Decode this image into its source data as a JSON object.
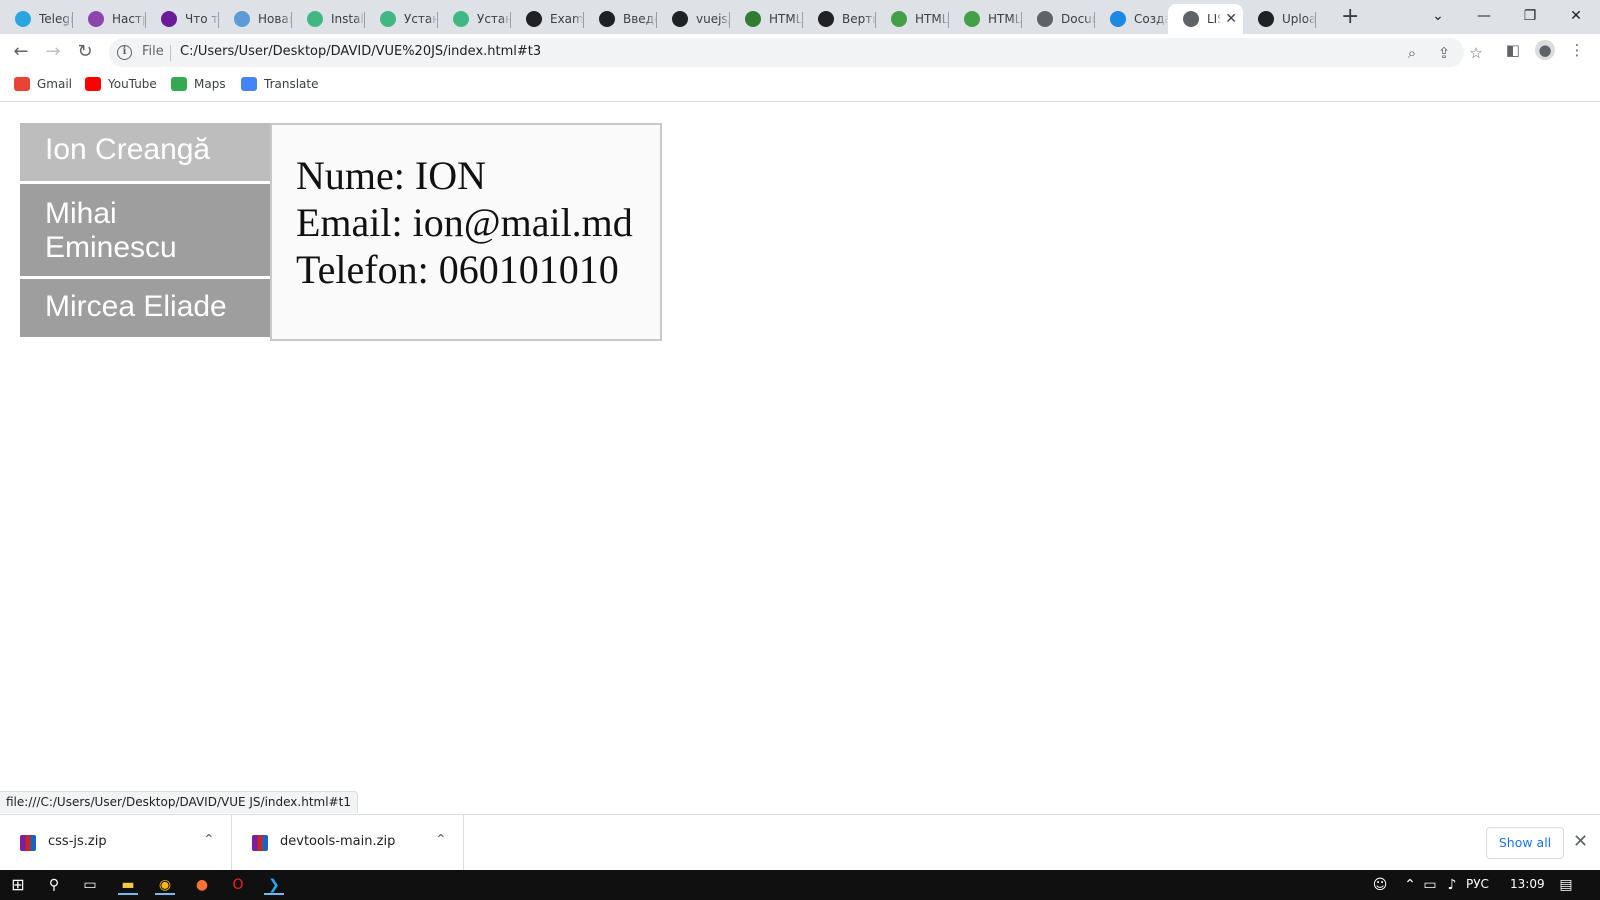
{
  "browser": {
    "tabs": [
      {
        "title": "Telegram",
        "icon": "telegram-icon",
        "color": "#2aa5e0"
      },
      {
        "title": "Настройка",
        "icon": "vue-icon",
        "color": "#8e44ad"
      },
      {
        "title": "Что такое",
        "icon": "flag-icon",
        "color": "#6a1b9a"
      },
      {
        "title": "Новая",
        "icon": "cloud-icon",
        "color": "#5c9bd6"
      },
      {
        "title": "Installation",
        "icon": "vue-icon",
        "color": "#41b883"
      },
      {
        "title": "Установка",
        "icon": "vue-icon",
        "color": "#41b883"
      },
      {
        "title": "Установка",
        "icon": "vue-icon",
        "color": "#41b883"
      },
      {
        "title": "Example",
        "icon": "codepen-icon",
        "color": "#202124"
      },
      {
        "title": "Введение",
        "icon": "m-icon",
        "color": "#202124"
      },
      {
        "title": "vuejs/",
        "icon": "github-icon",
        "color": "#202124"
      },
      {
        "title": "HTML",
        "icon": "leaf-icon",
        "color": "#2e7d32"
      },
      {
        "title": "Вертикальное",
        "icon": "codepen-icon",
        "color": "#202124"
      },
      {
        "title": "HTML",
        "icon": "check-icon",
        "color": "#43a047"
      },
      {
        "title": "HTML",
        "icon": "check-icon",
        "color": "#43a047"
      },
      {
        "title": "Document",
        "icon": "globe-icon",
        "color": "#5f6368"
      },
      {
        "title": "Создание",
        "icon": "c-icon",
        "color": "#1e88e5"
      },
      {
        "title": "LIST",
        "icon": "globe-icon",
        "color": "#5f6368",
        "active": true
      },
      {
        "title": "Upload",
        "icon": "github-icon",
        "color": "#202124"
      }
    ],
    "address": {
      "scheme_label": "File",
      "url": "C:/Users/User/Desktop/DAVID/VUE%20JS/index.html#t3"
    },
    "bookmarks": [
      {
        "label": "Gmail",
        "icon": "gmail-icon",
        "color": "#ea4335"
      },
      {
        "label": "YouTube",
        "icon": "youtube-icon",
        "color": "#ff0000"
      },
      {
        "label": "Maps",
        "icon": "maps-icon",
        "color": "#34a853"
      },
      {
        "label": "Translate",
        "icon": "translate-icon",
        "color": "#4285f4"
      }
    ],
    "status_url": "file:///C:/Users/User/Desktop/DAVID/VUE JS/index.html#t1"
  },
  "page": {
    "authors": [
      {
        "name": "Ion Creangă",
        "active": true
      },
      {
        "name": "Mihai Eminescu",
        "active": false
      },
      {
        "name": "Mircea Eliade",
        "active": false
      }
    ],
    "details": {
      "name_line": "Nume: ION",
      "email_line": "Email: ion@mail.md",
      "phone_line": "Telefon: 060101010"
    }
  },
  "downloads": {
    "items": [
      {
        "name": "css-js.zip"
      },
      {
        "name": "devtools-main.zip"
      }
    ],
    "show_all_label": "Show all"
  },
  "taskbar": {
    "language": "РУС",
    "time": "13:09"
  }
}
